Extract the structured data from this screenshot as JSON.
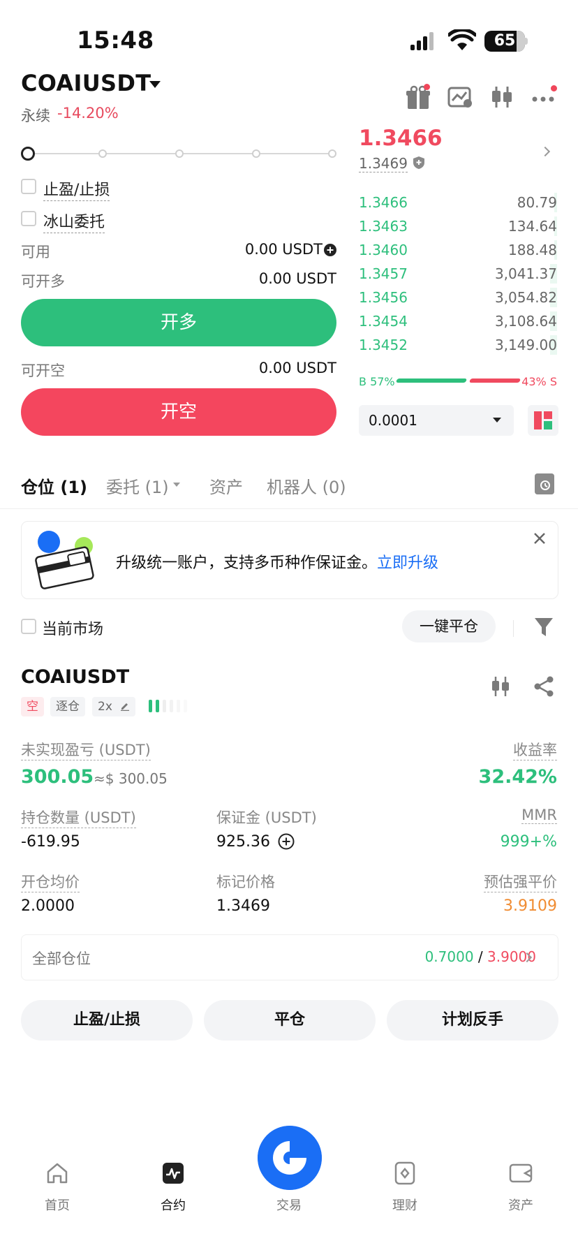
{
  "status_bar": {
    "time": "15:48",
    "battery": "65"
  },
  "header": {
    "symbol": "COAIUSDT",
    "contract_type": "永续",
    "change": "-14.20%"
  },
  "order_form": {
    "tp_sl_label": "止盈/止损",
    "iceberg_label": "冰山委托",
    "available_label": "可用",
    "available_value": "0.00 USDT",
    "can_long_label": "可开多",
    "can_long_value": "0.00 USDT",
    "long_button": "开多",
    "can_short_label": "可开空",
    "can_short_value": "0.00 USDT",
    "short_button": "开空",
    "leverage_slider_fraction": 0
  },
  "orderbook": {
    "last_price": "1.3466",
    "mark_price": "1.3469",
    "bids": [
      {
        "price": "1.3466",
        "amount": "80.79"
      },
      {
        "price": "1.3463",
        "amount": "134.64"
      },
      {
        "price": "1.3460",
        "amount": "188.48"
      },
      {
        "price": "1.3457",
        "amount": "3,041.37"
      },
      {
        "price": "1.3456",
        "amount": "3,054.82"
      },
      {
        "price": "1.3454",
        "amount": "3,108.64"
      },
      {
        "price": "1.3452",
        "amount": "3,149.00"
      }
    ],
    "buy_ratio": "B 57%",
    "sell_ratio": "43% S",
    "depth": "0.0001"
  },
  "tabs": [
    {
      "label": "仓位 (1)"
    },
    {
      "label": "委托 (1)"
    },
    {
      "label": "资产"
    },
    {
      "label": "机器人 (0)"
    }
  ],
  "banner": {
    "text": "升级统一账户，支持多币种作保证金。",
    "link": "立即升级"
  },
  "filters": {
    "current_market": "当前市场",
    "close_all": "一键平仓"
  },
  "position": {
    "symbol": "COAIUSDT",
    "side_tag": "空",
    "margin_mode_tag": "逐仓",
    "leverage_tag": "2x",
    "unrealized_pnl_label": "未实现盈亏 (USDT)",
    "unrealized_pnl": "300.05",
    "unrealized_pnl_approx": "≈$ 300.05",
    "roe_label": "收益率",
    "roe": "32.42%",
    "size_label": "持仓数量 (USDT)",
    "size": "-619.95",
    "margin_label": "保证金 (USDT)",
    "margin": "925.36",
    "mmr_label": "MMR",
    "mmr": "999+%",
    "entry_label": "开仓均价",
    "entry": "2.0000",
    "mark_label": "标记价格",
    "mark": "1.3469",
    "liq_label": "预估强平价",
    "liq": "3.9109",
    "all_positions_label": "全部仓位",
    "tp_value": "0.7000",
    "sep": "/",
    "sl_value": "3.9000",
    "actions": [
      "止盈/止损",
      "平仓",
      "计划反手"
    ]
  },
  "bottom_nav": [
    {
      "label": "首页",
      "icon": "home-icon"
    },
    {
      "label": "合约",
      "icon": "futures-icon"
    },
    {
      "label": "交易",
      "icon": "trade-icon"
    },
    {
      "label": "理财",
      "icon": "earn-icon"
    },
    {
      "label": "资产",
      "icon": "wallet-icon"
    }
  ],
  "colors": {
    "long": "#2dbf7c",
    "short": "#f4465e",
    "link": "#1a6ef5",
    "warning": "#f08c32"
  }
}
